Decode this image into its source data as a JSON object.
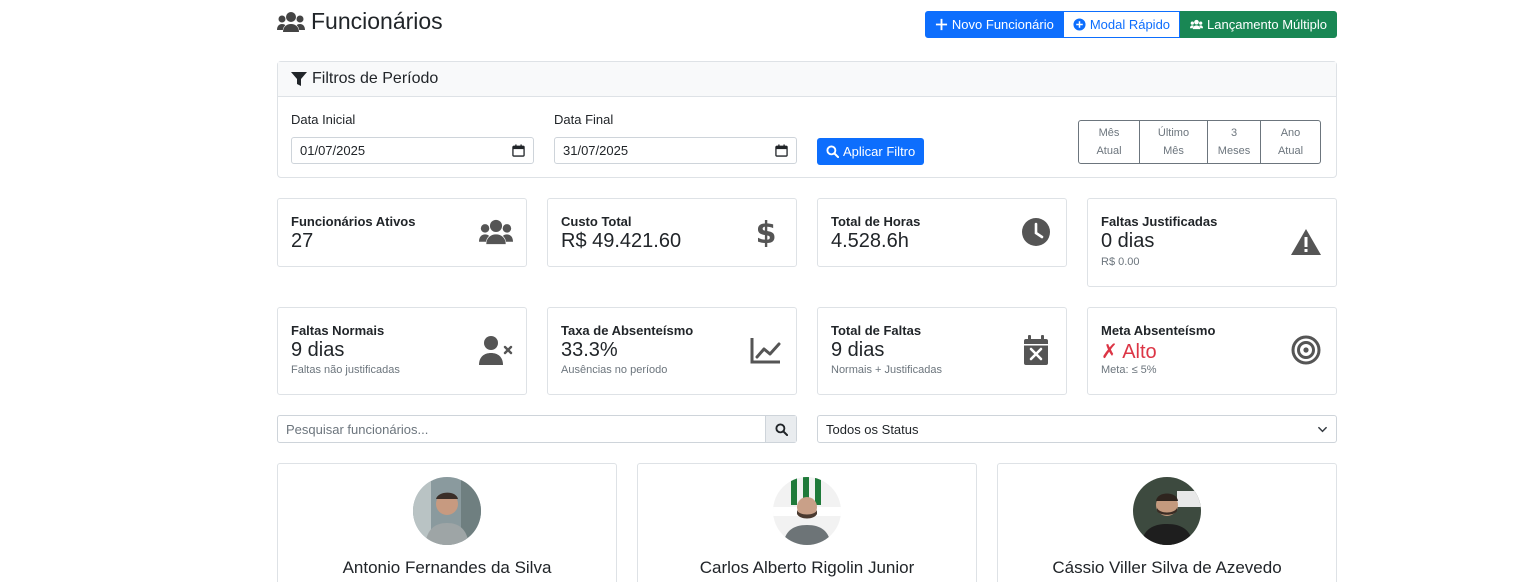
{
  "header": {
    "title": "Funcionários",
    "btn_new": "Novo Funcionário",
    "btn_modal": "Modal Rápido",
    "btn_multi": "Lançamento Múltiplo"
  },
  "filters": {
    "title": "Filtros de Período",
    "start_label": "Data Inicial",
    "start_value": "01/07/2025",
    "end_label": "Data Final",
    "end_value": "31/07/2025",
    "apply": "Aplicar Filtro",
    "periods": [
      {
        "l1": "Mês",
        "l2": "Atual"
      },
      {
        "l1": "Último",
        "l2": "Mês"
      },
      {
        "l1": "3",
        "l2": "Meses"
      },
      {
        "l1": "Ano",
        "l2": "Atual"
      }
    ]
  },
  "stats": [
    {
      "title": "Funcionários Ativos",
      "value": "27",
      "sub": "",
      "icon": "users-icon"
    },
    {
      "title": "Custo Total",
      "value": "R$ 49.421.60",
      "sub": "",
      "icon": "dollar-icon"
    },
    {
      "title": "Total de Horas",
      "value": "4.528.6h",
      "sub": "",
      "icon": "clock-icon"
    },
    {
      "title": "Faltas Justificadas",
      "value": "0 dias",
      "sub": "R$ 0.00",
      "icon": "warning-icon"
    },
    {
      "title": "Faltas Normais",
      "value": "9 dias",
      "sub": "Faltas não justificadas",
      "icon": "user-x-icon"
    },
    {
      "title": "Taxa de Absenteísmo",
      "value": "33.3%",
      "sub": "Ausências no período",
      "icon": "chart-line-icon"
    },
    {
      "title": "Total de Faltas",
      "value": "9 dias",
      "sub": "Normais + Justificadas",
      "icon": "calendar-x-icon"
    },
    {
      "title": "Meta Absenteísmo",
      "value": "✗ Alto",
      "sub": "Meta: ≤ 5%",
      "icon": "target-icon"
    }
  ],
  "search": {
    "placeholder": "Pesquisar funcionários..."
  },
  "status_select": {
    "value": "Todos os Status"
  },
  "employees": [
    {
      "name": "Antonio Fernandes da Silva"
    },
    {
      "name": "Carlos Alberto Rigolin Junior"
    },
    {
      "name": "Cássio Viller Silva de Azevedo"
    }
  ],
  "colors": {
    "primary": "#0d6efd",
    "success": "#198754",
    "danger": "#dc3545",
    "muted": "#6c757d"
  }
}
